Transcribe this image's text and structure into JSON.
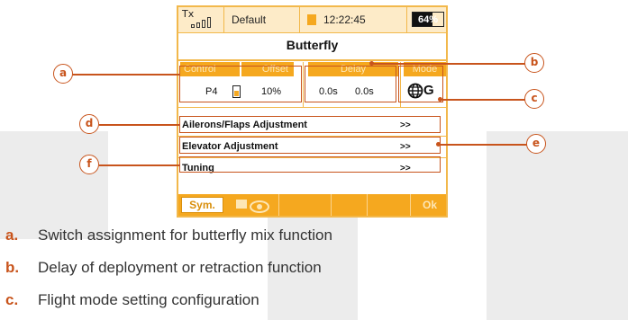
{
  "statusbar": {
    "tx_label": "Tx",
    "profile": "Default",
    "clock": "12:22:45",
    "battery_percent": "64%",
    "battery_level": 0.64
  },
  "screen": {
    "title": "Butterfly",
    "headers": {
      "control": "Control",
      "offset": "Offset",
      "delay": "Delay",
      "mode": "Mode"
    },
    "values": {
      "control": "P4",
      "offset": "10%",
      "delay_deploy": "0.0s",
      "delay_retract": "0.0s",
      "mode_glyph": "G"
    },
    "menu": [
      {
        "label": "Ailerons/Flaps Adjustment",
        "arrow": ">>"
      },
      {
        "label": "Elevator Adjustment",
        "arrow": ">>"
      },
      {
        "label": "Tuning",
        "arrow": ">>"
      }
    ],
    "footer": {
      "sym": "Sym.",
      "ok": "Ok"
    }
  },
  "callouts": [
    "a",
    "b",
    "c",
    "d",
    "e",
    "f"
  ],
  "legend": [
    {
      "letter": "a.",
      "text": "Switch assignment for butterfly mix function"
    },
    {
      "letter": "b.",
      "text": "Delay of deployment or retraction function"
    },
    {
      "letter": "c.",
      "text": "Flight mode setting configuration"
    }
  ],
  "colors": {
    "accent": "#f5a81f",
    "callout": "#c8541c",
    "background_block": "#ececec"
  }
}
